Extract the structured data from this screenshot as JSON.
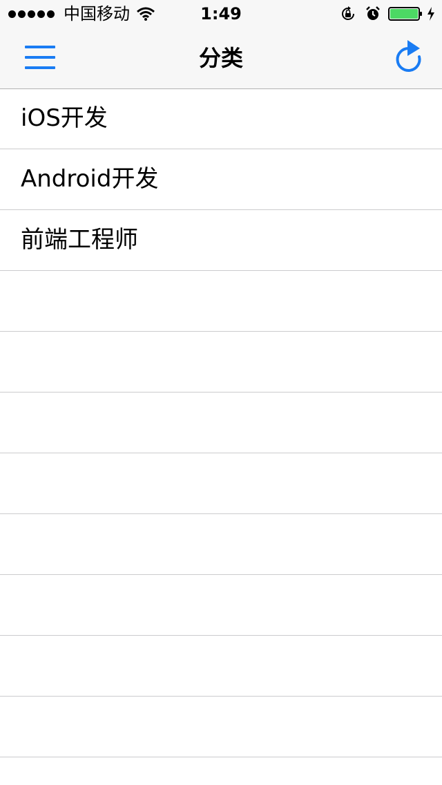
{
  "status_bar": {
    "signal_bars": 5,
    "carrier": "中国移动",
    "time": "1:49",
    "battery_level": 1.0,
    "battery_color": "#4cd964"
  },
  "nav_bar": {
    "title": "分类",
    "accent_color": "#1a7cf3",
    "left_icon": "hamburger-menu-icon",
    "right_icon": "refresh-icon"
  },
  "categories": [
    {
      "label": "iOS开发"
    },
    {
      "label": "Android开发"
    },
    {
      "label": "前端工程师"
    },
    {
      "label": ""
    },
    {
      "label": ""
    },
    {
      "label": ""
    },
    {
      "label": ""
    },
    {
      "label": ""
    },
    {
      "label": ""
    },
    {
      "label": ""
    },
    {
      "label": ""
    }
  ]
}
